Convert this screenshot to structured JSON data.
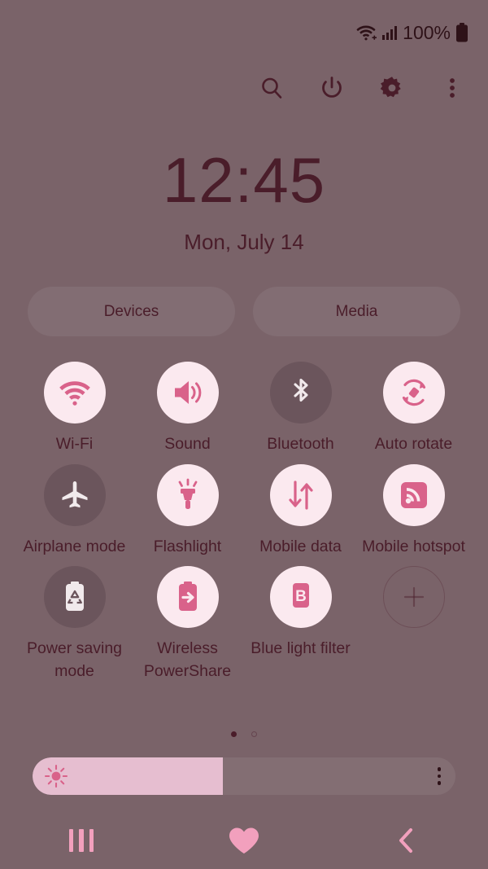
{
  "status_bar": {
    "wifi_icon": "wifi-icon",
    "signal_icon": "cellular-signal-icon",
    "battery_percent": "100%",
    "battery_icon": "battery-full-icon"
  },
  "header": {
    "search_icon": "search-icon",
    "power_icon": "power-icon",
    "settings_icon": "gear-icon",
    "more_icon": "more-vertical-icon"
  },
  "clock": {
    "time": "12:45",
    "date": "Mon, July 14"
  },
  "pills": [
    {
      "label": "Devices",
      "name": "devices-button"
    },
    {
      "label": "Media",
      "name": "media-button"
    }
  ],
  "toggles": [
    {
      "label": "Wi-Fi",
      "icon": "wifi-icon",
      "state": "on"
    },
    {
      "label": "Sound",
      "icon": "volume-icon",
      "state": "on"
    },
    {
      "label": "Bluetooth",
      "icon": "bluetooth-icon",
      "state": "off"
    },
    {
      "label": "Auto rotate",
      "icon": "auto-rotate-icon",
      "state": "on"
    },
    {
      "label": "Airplane mode",
      "icon": "airplane-icon",
      "state": "off"
    },
    {
      "label": "Flashlight",
      "icon": "flashlight-icon",
      "state": "on"
    },
    {
      "label": "Mobile data",
      "icon": "mobile-data-icon",
      "state": "on"
    },
    {
      "label": "Mobile hotspot",
      "icon": "hotspot-icon",
      "state": "on"
    },
    {
      "label": "Power saving mode",
      "icon": "power-saving-icon",
      "state": "off"
    },
    {
      "label": "Wireless PowerShare",
      "icon": "powershare-icon",
      "state": "on"
    },
    {
      "label": "Blue light filter",
      "icon": "blue-light-icon",
      "state": "on"
    },
    {
      "label": "",
      "icon": "add-icon",
      "state": "add"
    }
  ],
  "pager": {
    "total": 2,
    "active": 1
  },
  "brightness": {
    "icon": "brightness-icon",
    "value_percent": 45,
    "more_icon": "more-vertical-icon"
  },
  "navbar": {
    "recents_icon": "recents-icon",
    "home_icon": "heart-home-icon",
    "back_icon": "back-chevron-icon"
  },
  "colors": {
    "background": "#7a6369",
    "accent_pink": "#d9628a",
    "tile_on_bg": "#fbe9ef",
    "tile_off_bg": "#6b555c",
    "text_dark": "#4a1d2a",
    "slider_fill": "#e6bed0",
    "nav_pink": "#f2a0bd"
  }
}
